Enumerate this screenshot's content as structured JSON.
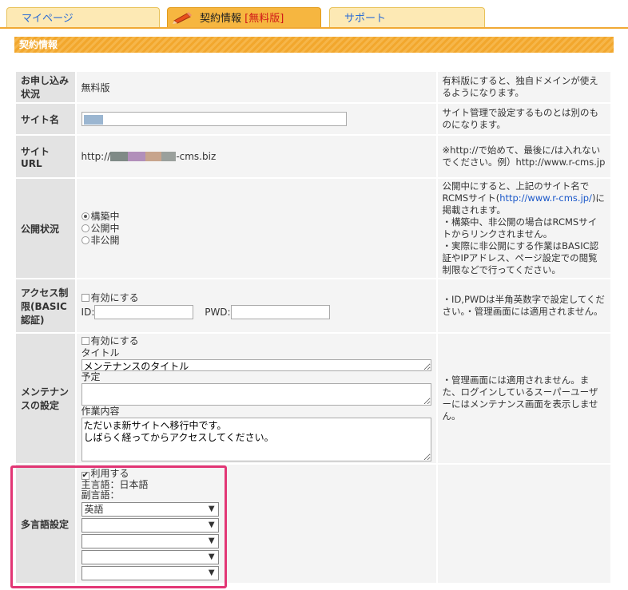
{
  "tabs": {
    "mypage": "マイページ",
    "contract": "契約情報",
    "contract_badge": "[無料版]",
    "support": "サポート"
  },
  "section_title": "契約情報",
  "rows": {
    "application": {
      "label": "お申し込み状況",
      "value": "無料版",
      "note": "有料版にすると、独自ドメインが使えるようになります。"
    },
    "site_name": {
      "label": "サイト名",
      "value": "",
      "note": "サイト管理で設定するものとは別のものになります。"
    },
    "site_url": {
      "label": "サイトURL",
      "prefix": "http://",
      "suffix": "-cms.biz",
      "note": "※http://で始めて、最後に/は入れないでください。例）http://www.r-cms.jp"
    },
    "publish": {
      "label": "公開状況",
      "options": [
        "構築中",
        "公開中",
        "非公開"
      ],
      "selected": "構築中",
      "note_1": "公開中にすると、上記のサイト名でRCMSサイト(",
      "note_link": "http://www.r-cms.jp/",
      "note_2": ")に掲載されます。",
      "note_3": "・構築中、非公開の場合はRCMSサイトからリンクされません。",
      "note_4": "・実際に非公開にする作業はBASIC認証やIPアドレス、ページ設定での閲覧制限などで行ってください。"
    },
    "access": {
      "label": "アクセス制限(BASIC認証)",
      "enable": "有効にする",
      "id_label": "ID:",
      "pwd_label": "PWD:",
      "id_value": "",
      "pwd_value": "",
      "note": "・ID,PWDは半角英数字で設定してください。・管理画面には適用されません。"
    },
    "maintenance": {
      "label": "メンテナンスの設定",
      "enable": "有効にする",
      "title_label": "タイトル",
      "title_value": "メンテナンスのタイトル",
      "schedule_label": "予定",
      "schedule_value": "",
      "work_label": "作業内容",
      "work_value": "ただいま新サイトへ移行中です。\nしばらく経ってからアクセスしてください。",
      "note": "・管理画面には適用されません。また、ログインしているスーパーユーザーにはメンテナンス画面を表示しません。"
    },
    "multilang": {
      "label": "多言語設定",
      "use": "利用する",
      "use_checked": true,
      "primary": "主言語：日本語",
      "secondary": "副言語：",
      "selects": [
        "英語",
        "",
        "",
        "",
        ""
      ]
    }
  },
  "colors": {
    "tab_active": "#f6b640",
    "tab_inactive": "#fde9b4",
    "section_bar": "#f2a72d",
    "highlight": "#e23675",
    "badge": "#d01818",
    "link": "#1a57c9"
  }
}
